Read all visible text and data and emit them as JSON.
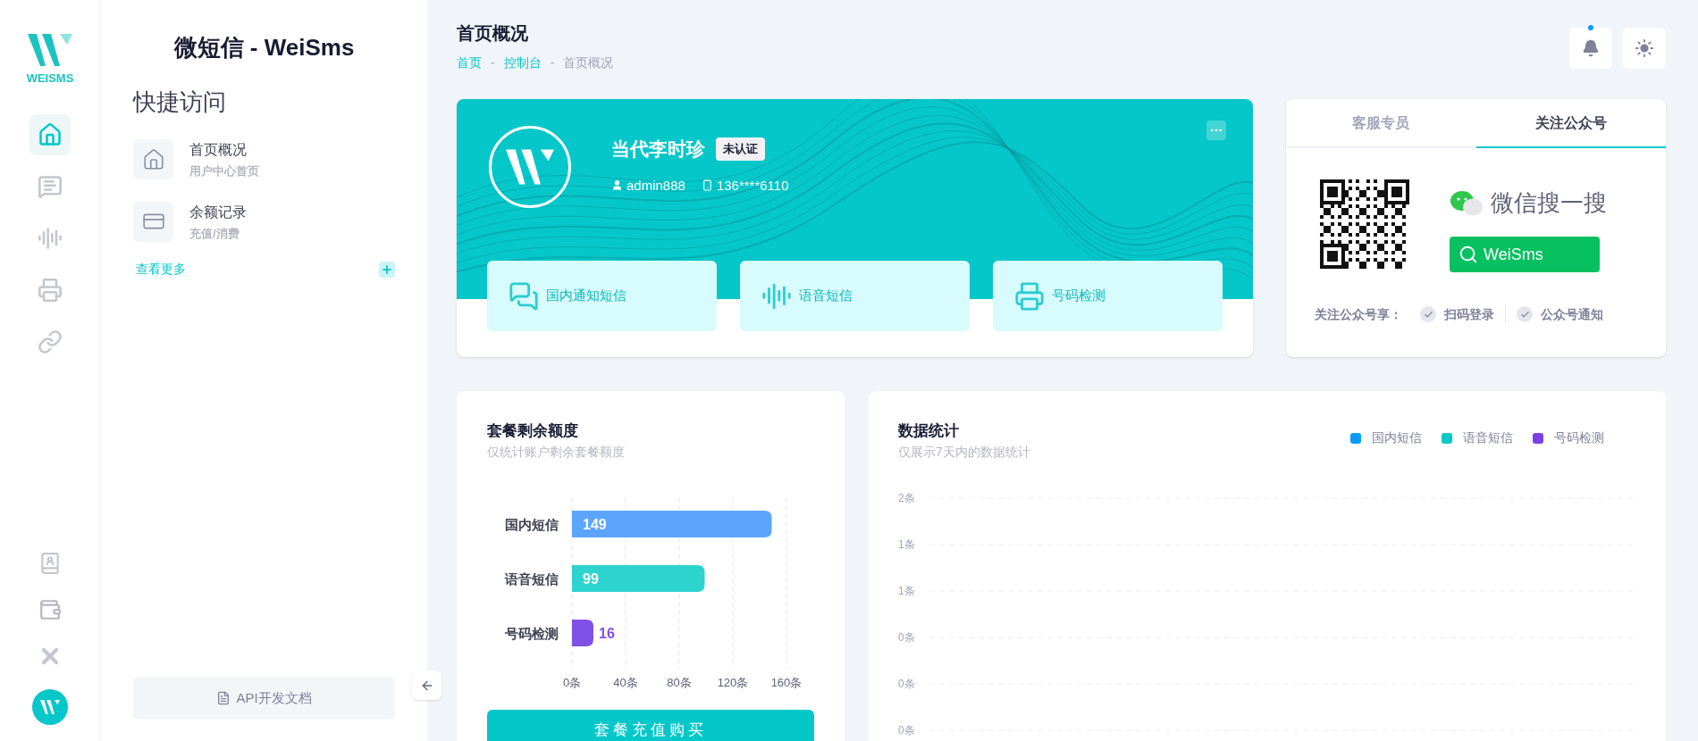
{
  "logo": {
    "text": "WEISMS"
  },
  "rail": {
    "items": [
      {
        "selected": true
      },
      {
        "selected": false
      },
      {
        "selected": false
      },
      {
        "selected": false
      },
      {
        "selected": false
      }
    ]
  },
  "panel": {
    "title": "微短信 - WeiSms",
    "section_title": "快捷访问",
    "items": [
      {
        "kind": "home",
        "title": "首页概况",
        "subtitle": "用户中心首页"
      },
      {
        "kind": "card",
        "title": "余额记录",
        "subtitle": "充值/消费"
      }
    ],
    "more_link": "查看更多",
    "docs_button": "API开发文档"
  },
  "header": {
    "title": "首页概况",
    "breadcrumb": [
      {
        "label": "首页",
        "current": false
      },
      {
        "label": "控制台",
        "current": false
      },
      {
        "label": "首页概况",
        "current": true
      }
    ],
    "separator": "-",
    "notification_dot": true
  },
  "profile": {
    "name": "当代李时珍",
    "badge": "未认证",
    "username": "admin888",
    "phone": "136****6110",
    "services": [
      {
        "kind": "sms",
        "label": "国内通知短信"
      },
      {
        "kind": "voice",
        "label": "语音短信"
      },
      {
        "kind": "check",
        "label": "号码检测"
      }
    ]
  },
  "follow_card": {
    "tabs": [
      {
        "label": "客服专员",
        "selected": false
      },
      {
        "label": "关注公众号",
        "selected": true
      }
    ],
    "search_title": "微信搜一搜",
    "search_button": "WeiSms",
    "benefits_label": "关注公众号享：",
    "benefits": [
      "扫码登录",
      "公众号通知"
    ]
  },
  "quota": {
    "title": "套餐剩余额度",
    "subtitle": "仅统计账户剩余套餐额度",
    "button": "套餐充值购买",
    "chart_data": {
      "type": "bar",
      "orientation": "horizontal",
      "categories": [
        "国内短信",
        "语音短信",
        "号码检测"
      ],
      "values": [
        149,
        99,
        16
      ],
      "colors": [
        "#5ba5ff",
        "#2dd3cf",
        "#8150e6"
      ],
      "data_labels": true,
      "grid": true,
      "xlim": [
        0,
        160
      ],
      "xticks": [
        {
          "value": 0,
          "label": "0条"
        },
        {
          "value": 40,
          "label": "40条"
        },
        {
          "value": 80,
          "label": "80条"
        },
        {
          "value": 120,
          "label": "120条"
        },
        {
          "value": 160,
          "label": "160条"
        }
      ]
    }
  },
  "stats": {
    "title": "数据统计",
    "subtitle": "仅展示7天内的数据统计",
    "legend": [
      {
        "name": "国内短信",
        "color": "#0b9bff"
      },
      {
        "name": "语音短信",
        "color": "#08c9c9"
      },
      {
        "name": "号码检测",
        "color": "#7b3fe4"
      }
    ],
    "y_axis_labels": [
      "2条",
      "1条",
      "1条",
      "0条",
      "0条",
      "0条"
    ]
  }
}
